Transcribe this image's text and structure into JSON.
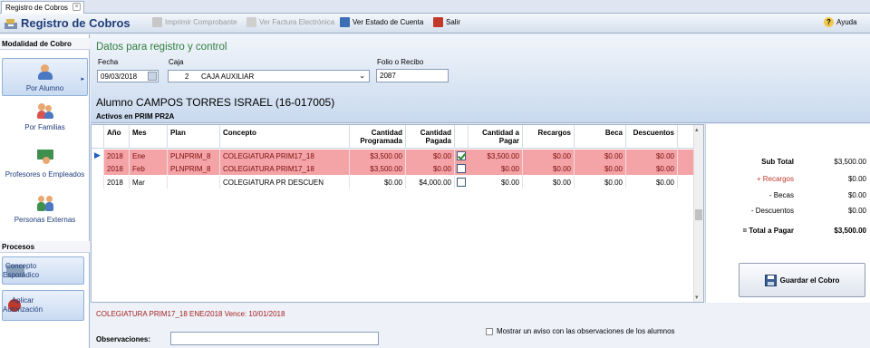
{
  "window_tab": {
    "title": "Registro de Cobros"
  },
  "toolbar": {
    "app_title": "Registro de Cobros",
    "imprimir": "Imprimir Comprobante",
    "factura": "Ver Factura Electrónica",
    "estado": "Ver Estado de Cuenta",
    "salir": "Salir",
    "ayuda": "Ayuda"
  },
  "sidebar": {
    "modalidad_title": "Modalidad de Cobro",
    "items": [
      {
        "label": "Por Alumno"
      },
      {
        "label": "Por Familias"
      },
      {
        "label": "Profesores o Empleados"
      },
      {
        "label": "Personas Externas"
      }
    ],
    "procesos_title": "Procesos",
    "procesos": [
      {
        "label_1": "Concepto",
        "label_2": "Esporádico"
      },
      {
        "label_1": "Aplicar",
        "label_2": "Autorización"
      }
    ]
  },
  "header": {
    "title": "Datos para registro y control",
    "fecha_label": "Fecha",
    "fecha_value": "09/03/2018",
    "caja_label": "Caja",
    "caja_num": "2",
    "caja_value": "CAJA AUXILIAR",
    "folio_label": "Folio o Recibo",
    "folio_value": "2087",
    "alumno": "Alumno CAMPOS TORRES ISRAEL (16-017005)",
    "activos": "Activos en PRIM PR2A"
  },
  "grid": {
    "columns": {
      "anio": "Año",
      "mes": "Mes",
      "plan": "Plan",
      "concepto": "Concepto",
      "programada_1": "Cantidad",
      "programada_2": "Programada",
      "pagada_1": "Cantidad",
      "pagada_2": "Pagada",
      "apagar_1": "Cantidad a",
      "apagar_2": "Pagar",
      "recargos": "Recargos",
      "beca": "Beca",
      "descuentos": "Descuentos"
    },
    "rows": [
      {
        "anio": "2018",
        "mes": "Ene",
        "plan": "PLNPRIM_8",
        "concepto": "COLEGIATURA PRIM17_18",
        "programada": "$3,500.00",
        "pagada": "$0.00",
        "checked": true,
        "apagar": "$3,500.00",
        "recargos": "$0.00",
        "beca": "$0.00",
        "descuentos": "$0.00"
      },
      {
        "anio": "2018",
        "mes": "Feb",
        "plan": "PLNPRIM_8",
        "concepto": "COLEGIATURA PRIM17_18",
        "programada": "$3,500.00",
        "pagada": "$0.00",
        "checked": false,
        "apagar": "$0.00",
        "recargos": "$0.00",
        "beca": "$0.00",
        "descuentos": "$0.00"
      },
      {
        "anio": "2018",
        "mes": "Mar",
        "plan": "",
        "concepto": "COLEGIATURA PR DESCUEN",
        "programada": "$0.00",
        "pagada": "$4,000.00",
        "checked": false,
        "apagar": "$0.00",
        "recargos": "$0.00",
        "beca": "$0.00",
        "descuentos": "$0.00"
      }
    ]
  },
  "totals": {
    "subtotal_label": "Sub Total",
    "subtotal": "$3,500.00",
    "recargos_label": "+ Recargos",
    "recargos": "$0.00",
    "becas_label": "- Becas",
    "becas": "$0.00",
    "descuentos_label": "- Descuentos",
    "descuentos": "$0.00",
    "total_label": "= Total a Pagar",
    "total": "$3,500.00",
    "save": "Guardar el Cobro"
  },
  "footer": {
    "info": "COLEGIATURA PRIM17_18 ENE/2018 Vence: 10/01/2018",
    "observaciones_label": "Observaciones:",
    "aviso": "Mostrar un aviso con las observaciones de los alumnos"
  },
  "colors": {
    "row_pink": "#f4a3a6",
    "row_text": "#7a0d0d",
    "accent_blue": "#1f3d7a",
    "green_title": "#2f7d3c"
  }
}
